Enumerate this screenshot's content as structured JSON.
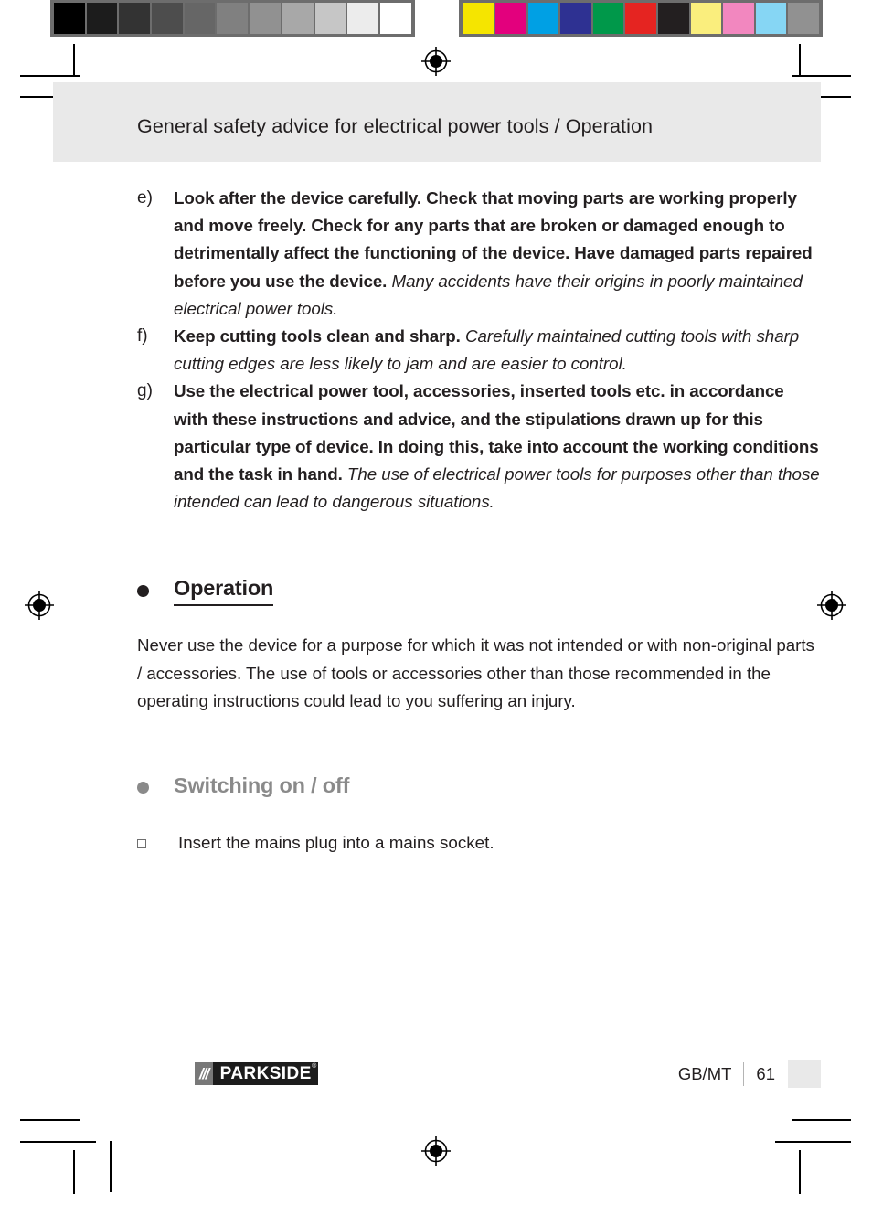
{
  "calibration": {
    "grayscale_swatches": [
      "#000000",
      "#1c1c1c",
      "#333333",
      "#4d4d4d",
      "#666666",
      "#808080",
      "#919191",
      "#a8a8a8",
      "#c6c6c6",
      "#ececec",
      "#ffffff"
    ],
    "color_swatches": [
      "#f5e500",
      "#e3007d",
      "#00a0e4",
      "#2e3192",
      "#00984a",
      "#e52421",
      "#231f20",
      "#faee7d",
      "#f287bf",
      "#86d6f4",
      "#919191"
    ]
  },
  "header": {
    "title": "General safety advice for electrical power tools / Operation"
  },
  "safety_list": [
    {
      "marker": "e)",
      "lead": "Look after the device carefully. Check that moving parts are working properly and move freely. Check for any parts that are broken or damaged enough to detrimentally affect the functioning of the device. Have damaged parts repaired before you use the device.",
      "explanation": "Many accidents have their origins in poorly maintained electrical power tools."
    },
    {
      "marker": "f)",
      "lead": "Keep cutting tools clean and sharp.",
      "explanation": "Carefully maintained cutting tools with sharp cutting edges are less likely to jam and are easier to control."
    },
    {
      "marker": "g)",
      "lead": "Use the electrical power tool, accessories, inserted tools etc. in accordance with these instructions and advice, and the stipulations drawn up for this particular type of device. In doing this, take into account the working conditions and the task in hand.",
      "explanation": "The use of electrical power tools for purposes other than those intended can lead to dangerous situations."
    }
  ],
  "sections": [
    {
      "heading": "Operation",
      "style": "dark",
      "paragraph": "Never use the device for a purpose for which it was not intended or with non-original parts / accessories. The use of tools or accessories other than those recommended in the operating instructions could lead to you suffering an injury."
    },
    {
      "heading": "Switching on / off",
      "style": "gray",
      "steps": [
        "Insert the mains plug into a mains socket."
      ]
    }
  ],
  "footer": {
    "logo_slashes": "///",
    "logo_word": "PARKSIDE",
    "logo_registered": "®",
    "locale": "GB/MT",
    "page_number": "61"
  }
}
